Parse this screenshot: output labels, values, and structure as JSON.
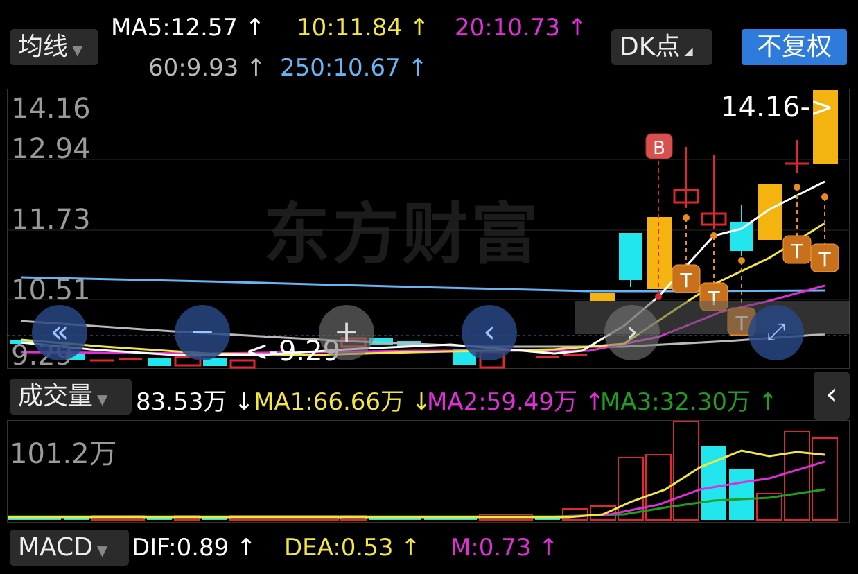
{
  "header": {
    "ma_dropdown_label": "均线",
    "ma5": "MA5:12.57 ↑",
    "ma10": "10:11.84 ↑",
    "ma20": "20:10.73 ↑",
    "ma60": "60:9.93 ↑",
    "ma250": "250:10.67 ↑",
    "dk_button": "DK点",
    "fuquan_button": "不复权"
  },
  "price_panel": {
    "y_labels": [
      "14.16",
      "12.94",
      "11.73",
      "10.51",
      "9.29"
    ],
    "max_marker": "14.16->",
    "min_marker": "<-9.29",
    "watermark": "东方财富",
    "b_marker": "B",
    "t_marker": "T"
  },
  "volume_header": {
    "dropdown_label": "成交量",
    "vol": "83.53万 ↓",
    "ma1": "MA1:66.66万 ↓",
    "ma2": "MA2:59.49万 ↑",
    "ma3": "MA3:32.30万 ↑"
  },
  "volume_panel": {
    "y_label": "101.2万"
  },
  "macd_header": {
    "dropdown_label": "MACD",
    "dif": "DIF:0.89 ↑",
    "dea": "DEA:0.53 ↑",
    "m": "M:0.73 ↑"
  },
  "colors": {
    "up": "#e0282e",
    "down": "#22e6ee",
    "up_fill": "#f5b30f",
    "ma5": "#ffffff",
    "ma10": "#f2e640",
    "ma20": "#e02fd9",
    "ma60": "#b9b9b9",
    "ma250": "#69b4f2",
    "ma3": "#1f9e1f"
  },
  "icons": [
    "double-left-icon",
    "minus-icon",
    "plus-icon",
    "left-icon",
    "right-icon",
    "expand-icon",
    "collapse-panel-icon"
  ]
}
